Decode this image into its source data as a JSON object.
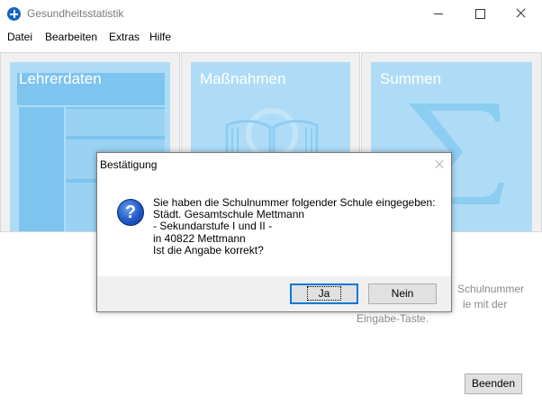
{
  "window": {
    "title": "Gesundheitsstatistik"
  },
  "menu": {
    "items": [
      "Datei",
      "Bearbeiten",
      "Extras",
      "Hilfe"
    ]
  },
  "tiles": [
    {
      "label": "Lehrerdaten",
      "icon": "grid-icon"
    },
    {
      "label": "Maßnahmen",
      "icon": "book-icon"
    },
    {
      "label": "Summen",
      "icon": "sigma-icon"
    }
  ],
  "hint": {
    "line1": "Schulnummer",
    "line2": "ie mit der",
    "line3": "Eingabe-Taste."
  },
  "end_button": "Beenden",
  "dialog": {
    "title": "Bestätigung",
    "icon": "question-icon",
    "message": "Sie haben die Schulnummer folgender Schule eingegeben:\nStädt. Gesamtschule Mettmann\n- Sekundarstufe I und II -\nin 40822 Mettmann\nIst die Angabe korrekt?",
    "yes_label": "Ja",
    "no_label": "Nein"
  },
  "colors": {
    "tile_fill": "#aedcf6",
    "tile_accent": "#7dc4ef",
    "focus_border": "#0078d7"
  }
}
